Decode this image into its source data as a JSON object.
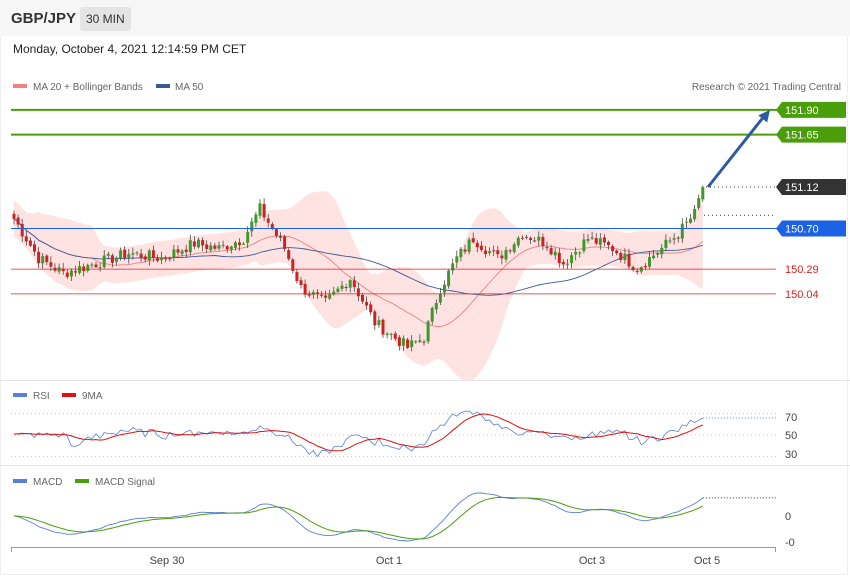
{
  "header": {
    "symbol": "GBP/JPY",
    "interval": "30 MIN",
    "datetime": "Monday, October 4, 2021 12:14:59 PM CET",
    "copyright": "Research © 2021 Trading Central"
  },
  "colors": {
    "resistance": "#4a9e0a",
    "pivot": "#1b62e6",
    "support": "#dd2222",
    "last_price": "#333333",
    "bollinger_fill": "#ffd8d8",
    "ma20": "#f08080",
    "ma50": "#3a5a95",
    "candle_up": "#3a9a2a",
    "candle_down": "#cc2222",
    "rsi": "#5a7fd6",
    "rsi_ma": "#dd1111",
    "macd": "#5a7fd6",
    "macd_signal": "#4a9e0a",
    "arrow": "#2e5aa0"
  },
  "chart_data": [
    {
      "type": "candlestick",
      "legend": [
        {
          "name": "MA 20 + Bollinger Bands",
          "color": "#f08080"
        },
        {
          "name": "MA 50",
          "color": "#3a5a95"
        }
      ],
      "x_ticks": [
        "Sep 30",
        "Oct 1",
        "Oct 3",
        "Oct 5"
      ],
      "ylim": [
        149.25,
        152.05
      ],
      "levels": [
        {
          "value": 151.9,
          "label": "151.90",
          "kind": "resistance"
        },
        {
          "value": 151.65,
          "label": "151.65",
          "kind": "resistance"
        },
        {
          "value": 151.12,
          "label": "151.12",
          "kind": "last"
        },
        {
          "value": 150.7,
          "label": "150.70",
          "kind": "pivot"
        },
        {
          "value": 150.29,
          "label": "150.29",
          "kind": "support"
        },
        {
          "value": 150.04,
          "label": "150.04",
          "kind": "support"
        }
      ],
      "forecast_arrow": {
        "from": 151.12,
        "to": 151.9
      },
      "price_anchors": [
        [
          0,
          150.8
        ],
        [
          6,
          150.4
        ],
        [
          12,
          150.25
        ],
        [
          20,
          150.35
        ],
        [
          28,
          150.45
        ],
        [
          36,
          150.4
        ],
        [
          44,
          150.55
        ],
        [
          50,
          150.5
        ],
        [
          56,
          150.6
        ],
        [
          60,
          150.9
        ],
        [
          66,
          150.5
        ],
        [
          70,
          150.1
        ],
        [
          76,
          149.95
        ],
        [
          82,
          150.2
        ],
        [
          88,
          149.75
        ],
        [
          96,
          149.5
        ],
        [
          100,
          149.6
        ],
        [
          104,
          150.1
        ],
        [
          108,
          150.4
        ],
        [
          112,
          150.6
        ],
        [
          118,
          150.4
        ],
        [
          124,
          150.65
        ],
        [
          130,
          150.55
        ],
        [
          134,
          150.35
        ],
        [
          140,
          150.6
        ],
        [
          146,
          150.5
        ],
        [
          152,
          150.3
        ],
        [
          158,
          150.5
        ],
        [
          162,
          150.65
        ],
        [
          166,
          150.85
        ],
        [
          168,
          151.12
        ]
      ]
    },
    {
      "type": "line",
      "legend": [
        {
          "name": "RSI",
          "color": "#5a7fd6"
        },
        {
          "name": "9MA",
          "color": "#dd1111"
        }
      ],
      "ylim": [
        25,
        75
      ],
      "y_ticks": [
        70,
        50,
        30
      ]
    },
    {
      "type": "line",
      "legend": [
        {
          "name": "MACD",
          "color": "#5a7fd6"
        },
        {
          "name": "MACD Signal",
          "color": "#4a9e0a"
        }
      ],
      "y_ticks": [
        "0",
        "-0"
      ]
    }
  ]
}
